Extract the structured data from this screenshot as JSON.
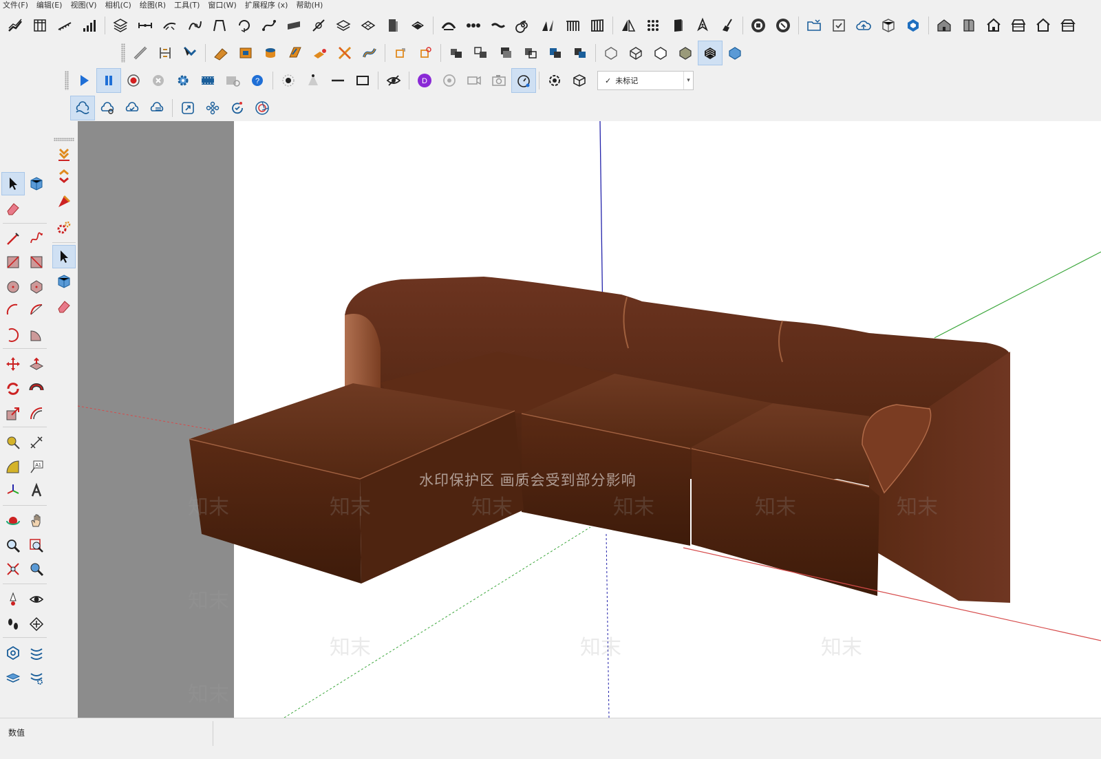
{
  "menu": {
    "items": [
      {
        "label": "文件(F)"
      },
      {
        "label": "编辑(E)"
      },
      {
        "label": "视图(V)"
      },
      {
        "label": "相机(C)"
      },
      {
        "label": "绘图(R)"
      },
      {
        "label": "工具(T)"
      },
      {
        "label": "窗口(W)"
      },
      {
        "label": "扩展程序 (x)"
      },
      {
        "label": "帮助(H)"
      }
    ]
  },
  "toolbar": {
    "tag_select": {
      "check": "✓",
      "value": "未标记"
    }
  },
  "viewport": {
    "watermark_text": "水印保护区   画质会受到部分影响",
    "watermark_brand": "知末",
    "model": "sectional-sofa",
    "sofa_color": "#6b3520",
    "axis_colors": {
      "red": "#d64a4a",
      "green": "#3aa63a",
      "blue": "#2222aa"
    }
  },
  "statusbar": {
    "measurements_label": "数值"
  }
}
